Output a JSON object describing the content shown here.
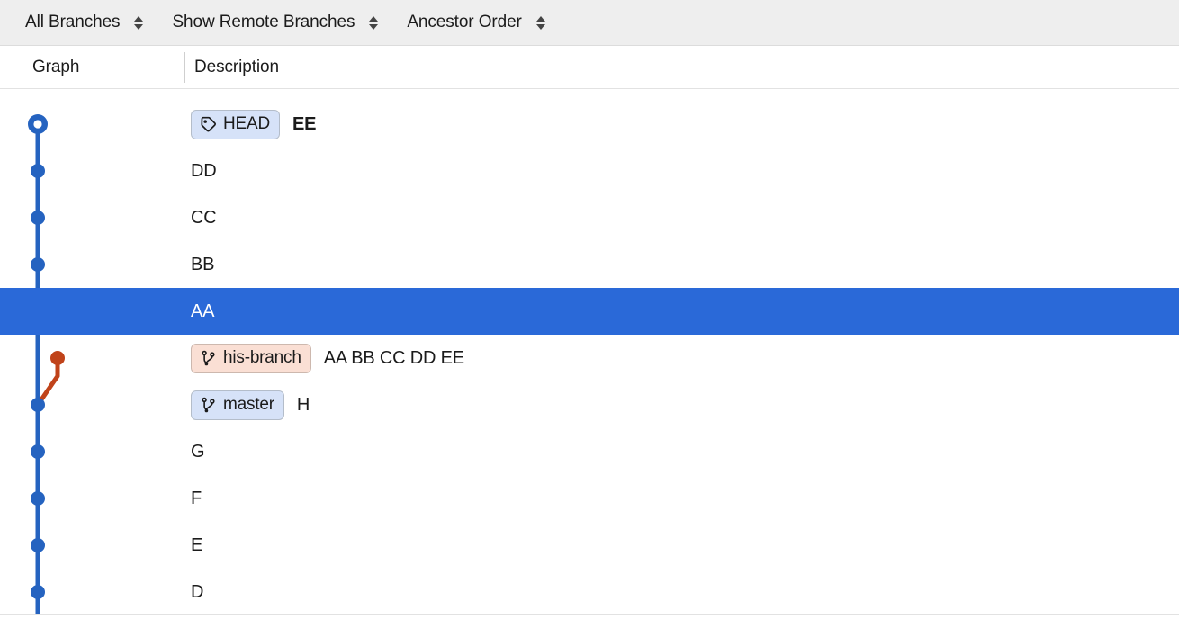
{
  "toolbar": {
    "filters": [
      {
        "label": "All Branches",
        "stepper_icon": "stepper-updown-icon"
      },
      {
        "label": "Show Remote Branches",
        "stepper_icon": "stepper-updown-icon"
      },
      {
        "label": "Ancestor Order",
        "stepper_icon": "stepper-updown-icon"
      }
    ]
  },
  "columns": {
    "graph": "Graph",
    "description": "Description"
  },
  "colors": {
    "toolbar_bg": "#eeeeee",
    "branch_blue": "#2563c0",
    "branch_orange": "#c0431a",
    "selection_blue": "#2a69d8",
    "badge_blue_bg": "#d6e2f8",
    "badge_peach_bg": "#fadfd4",
    "text": "#1b1b1b"
  },
  "rows": [
    {
      "id": "r0",
      "message": "EE",
      "bold": true,
      "selected": false,
      "refs": [
        {
          "name": "HEAD",
          "kind": "head",
          "icon": "tag-icon",
          "style": "blue"
        }
      ],
      "node": {
        "lane": 0,
        "type": "ring-large",
        "color": "#2563c0"
      }
    },
    {
      "id": "r1",
      "message": "DD",
      "bold": false,
      "selected": false,
      "refs": [],
      "node": {
        "lane": 0,
        "type": "dot",
        "color": "#2563c0"
      }
    },
    {
      "id": "r2",
      "message": "CC",
      "bold": false,
      "selected": false,
      "refs": [],
      "node": {
        "lane": 0,
        "type": "dot",
        "color": "#2563c0"
      }
    },
    {
      "id": "r3",
      "message": "BB",
      "bold": false,
      "selected": false,
      "refs": [],
      "node": {
        "lane": 0,
        "type": "dot",
        "color": "#2563c0"
      }
    },
    {
      "id": "r4",
      "message": "AA",
      "bold": false,
      "selected": true,
      "refs": [],
      "node": {
        "lane": 0,
        "type": "dot-ringed",
        "color": "#2563c0"
      }
    },
    {
      "id": "r5",
      "message": "AA BB CC DD EE",
      "bold": false,
      "selected": false,
      "refs": [
        {
          "name": "his-branch",
          "kind": "branch",
          "icon": "git-branch-icon",
          "style": "peach"
        }
      ],
      "node": {
        "lane": 1,
        "type": "dot",
        "color": "#c0431a"
      }
    },
    {
      "id": "r6",
      "message": "H",
      "bold": false,
      "selected": false,
      "refs": [
        {
          "name": "master",
          "kind": "branch",
          "icon": "git-branch-icon",
          "style": "blue"
        }
      ],
      "node": {
        "lane": 0,
        "type": "dot",
        "color": "#2563c0"
      }
    },
    {
      "id": "r7",
      "message": "G",
      "bold": false,
      "selected": false,
      "refs": [],
      "node": {
        "lane": 0,
        "type": "dot",
        "color": "#2563c0"
      }
    },
    {
      "id": "r8",
      "message": "F",
      "bold": false,
      "selected": false,
      "refs": [],
      "node": {
        "lane": 0,
        "type": "dot",
        "color": "#2563c0"
      }
    },
    {
      "id": "r9",
      "message": "E",
      "bold": false,
      "selected": false,
      "refs": [],
      "node": {
        "lane": 0,
        "type": "dot",
        "color": "#2563c0"
      }
    },
    {
      "id": "r10",
      "message": "D",
      "bold": false,
      "selected": false,
      "refs": [],
      "node": {
        "lane": 0,
        "type": "dot",
        "color": "#2563c0"
      }
    }
  ]
}
